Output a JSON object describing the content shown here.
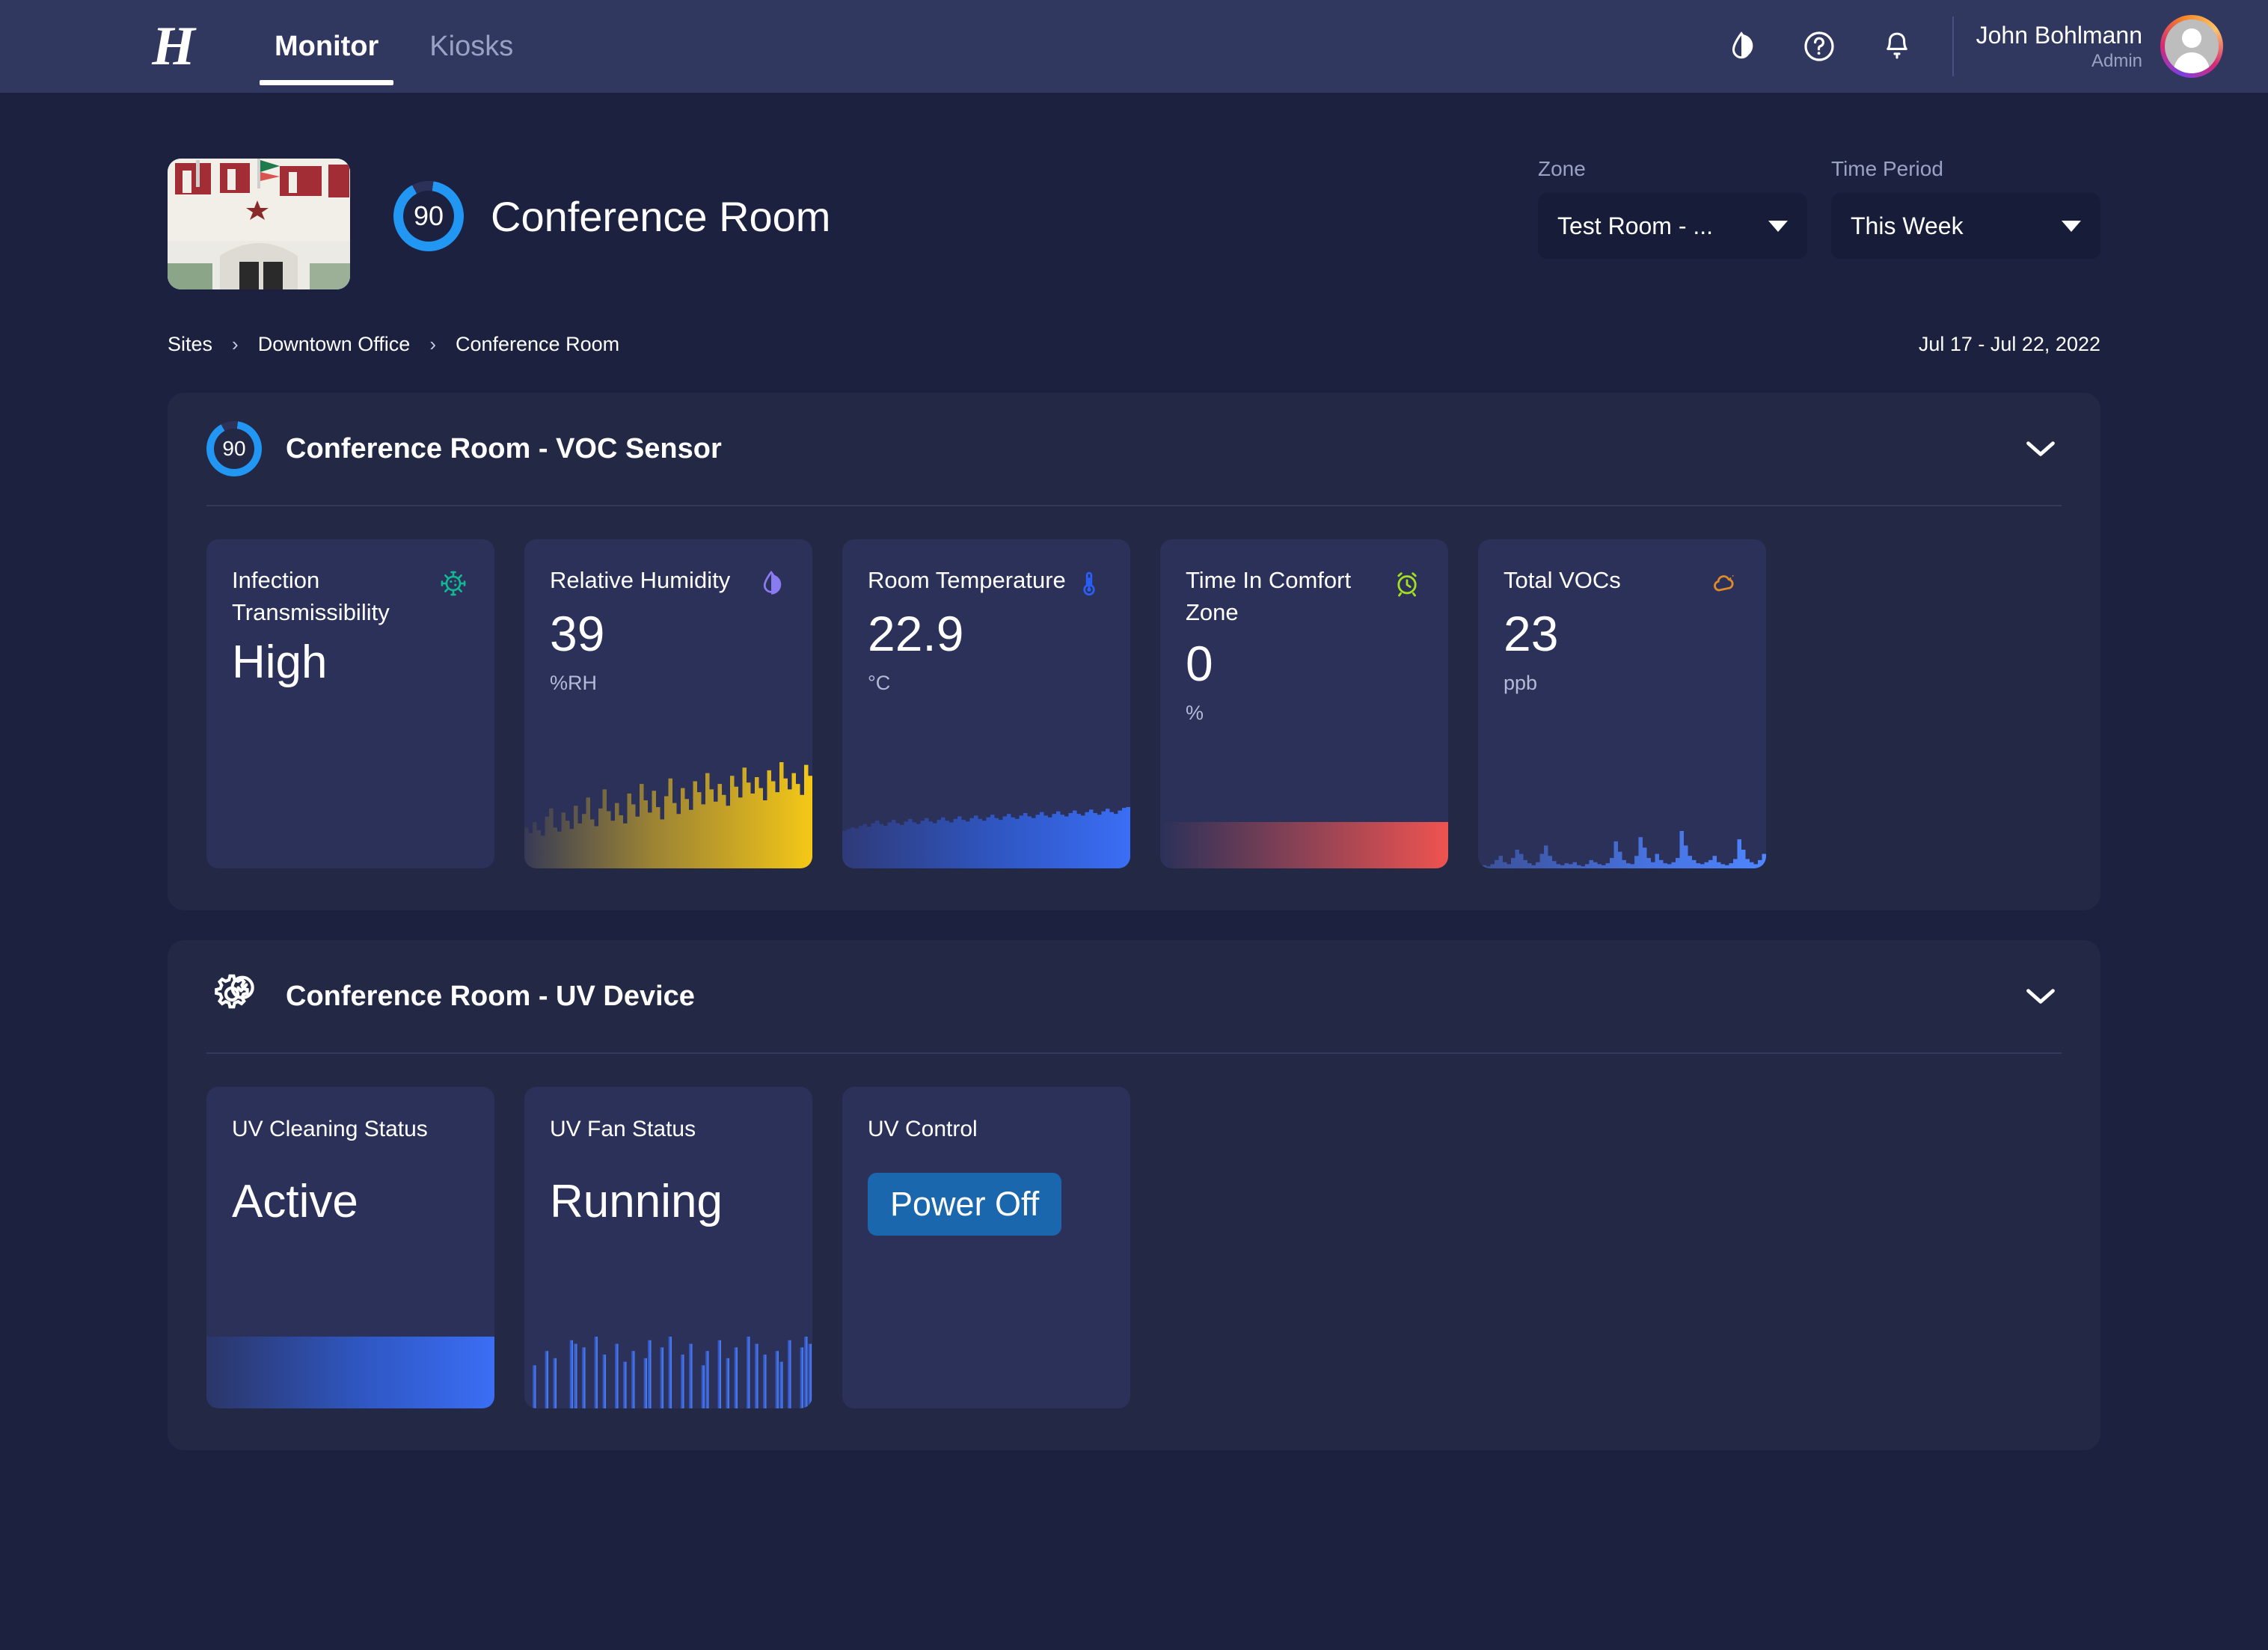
{
  "topbar": {
    "logo_text": "H",
    "tabs": [
      {
        "label": "Monitor",
        "active": true
      },
      {
        "label": "Kiosks",
        "active": false
      }
    ],
    "icons": [
      "contrast-droplet-icon",
      "help-icon",
      "notification-bell-icon"
    ],
    "user": {
      "name": "John Bohlmann",
      "role": "Admin"
    }
  },
  "pagehead": {
    "score": "90",
    "title": "Conference Room",
    "zone": {
      "label": "Zone",
      "value": "Test Room - ..."
    },
    "time_period": {
      "label": "Time Period",
      "value": "This Week"
    }
  },
  "breadcrumb": {
    "items": [
      "Sites",
      "Downtown Office",
      "Conference Room"
    ],
    "separator": "›",
    "date_range": "Jul 17 - Jul 22, 2022"
  },
  "panels": [
    {
      "score": "90",
      "title": "Conference Room - VOC Sensor",
      "cards": [
        {
          "label": "Infection Transmissibility",
          "value": "High",
          "unit": "",
          "icon": "virus-icon",
          "icon_color": "#12b894",
          "chart": "none"
        },
        {
          "label": "Relative Humidity",
          "value": "39",
          "unit": "%RH",
          "icon": "humidity-droplet-icon",
          "icon_color": "#8a7bf0",
          "chart": "gold-area"
        },
        {
          "label": "Room Temperature",
          "value": "22.9",
          "unit": "°C",
          "icon": "thermometer-icon",
          "icon_color": "#2a5ff5",
          "chart": "blue-area"
        },
        {
          "label": "Time In Comfort Zone",
          "value": "0",
          "unit": "%",
          "icon": "alarm-clock-icon",
          "icon_color": "#a4e021",
          "chart": "red-band"
        },
        {
          "label": "Total VOCs",
          "value": "23",
          "unit": "ppb",
          "icon": "odor-cloud-icon",
          "icon_color": "#e08b28",
          "chart": "voc-spikes"
        }
      ]
    },
    {
      "icon": "gear-check-icon",
      "title": "Conference Room - UV Device",
      "cards": [
        {
          "label": "UV Cleaning Status",
          "value": "Active",
          "chart": "solid-blue-band"
        },
        {
          "label": "UV Fan Status",
          "value": "Running",
          "chart": "blue-bars"
        },
        {
          "label": "UV Control",
          "button": "Power Off",
          "chart": "none"
        }
      ]
    }
  ],
  "colors": {
    "page_bg": "#1c2140",
    "topbar_bg": "#313860",
    "panel_bg": "#232845",
    "card_bg": "#2b3159",
    "accent_blue": "#2196f3",
    "button_blue": "#1b67ad",
    "gold": "#f0c419",
    "red": "#ef5350"
  },
  "chart_data": [
    {
      "type": "area",
      "title": "Relative Humidity",
      "ylabel": "%RH",
      "values": [
        30,
        26,
        34,
        28,
        24,
        38,
        44,
        30,
        27,
        41,
        35,
        29,
        46,
        33,
        40,
        52,
        36,
        31,
        44,
        58,
        42,
        35,
        48,
        39,
        33,
        55,
        47,
        38,
        62,
        50,
        41,
        57,
        45,
        36,
        53,
        66,
        48,
        40,
        59,
        51,
        43,
        64,
        56,
        47,
        70,
        58,
        49,
        62,
        54,
        46,
        68,
        60,
        52,
        74,
        63,
        55,
        67,
        59,
        50,
        72,
        64,
        56,
        78,
        66,
        58,
        70,
        62,
        54,
        76,
        68
      ]
    },
    {
      "type": "area",
      "title": "Room Temperature",
      "ylabel": "°C",
      "values": [
        44,
        46,
        48,
        47,
        50,
        52,
        49,
        53,
        56,
        52,
        50,
        54,
        57,
        53,
        51,
        55,
        58,
        54,
        52,
        56,
        59,
        55,
        53,
        57,
        60,
        56,
        54,
        58,
        61,
        57,
        55,
        59,
        62,
        58,
        56,
        60,
        63,
        59,
        57,
        61,
        64,
        60,
        58,
        62,
        65,
        61,
        59,
        63,
        66,
        62,
        60,
        64,
        67,
        63,
        61,
        65,
        68,
        64,
        62,
        66,
        69,
        65,
        63,
        67,
        70,
        66,
        64,
        68,
        71,
        72
      ]
    },
    {
      "type": "area",
      "title": "Time In Comfort Zone",
      "ylabel": "%",
      "values": [
        0,
        0,
        0,
        0,
        0,
        0,
        0,
        0,
        0,
        0,
        0,
        0,
        0,
        0,
        0,
        0,
        0,
        0,
        0,
        0
      ]
    },
    {
      "type": "area",
      "title": "Total VOCs",
      "ylabel": "ppb",
      "values": [
        2,
        3,
        2,
        4,
        8,
        12,
        6,
        4,
        10,
        18,
        14,
        8,
        5,
        3,
        6,
        14,
        22,
        12,
        7,
        4,
        3,
        5,
        4,
        6,
        3,
        2,
        4,
        8,
        6,
        4,
        3,
        5,
        10,
        26,
        16,
        8,
        5,
        4,
        12,
        30,
        20,
        10,
        6,
        14,
        8,
        5,
        4,
        6,
        10,
        36,
        22,
        12,
        8,
        5,
        4,
        6,
        8,
        12,
        6,
        4,
        3,
        5,
        9,
        28,
        18,
        9,
        6,
        4,
        8,
        14
      ]
    },
    {
      "type": "area",
      "title": "UV Cleaning Status",
      "values": [
        100,
        100,
        100,
        100,
        100,
        100,
        100,
        100,
        100,
        100,
        100,
        100,
        100,
        100,
        100,
        100,
        100,
        100,
        100,
        100
      ]
    },
    {
      "type": "bar",
      "title": "UV Fan Status",
      "values": [
        0,
        0,
        60,
        0,
        0,
        80,
        0,
        70,
        0,
        0,
        0,
        95,
        90,
        0,
        85,
        0,
        0,
        100,
        0,
        75,
        0,
        0,
        90,
        0,
        65,
        0,
        80,
        0,
        0,
        70,
        95,
        0,
        0,
        85,
        0,
        100,
        0,
        0,
        75,
        0,
        90,
        0,
        0,
        60,
        80,
        0,
        0,
        95,
        0,
        70,
        0,
        85,
        0,
        0,
        100,
        0,
        90,
        0,
        75,
        0,
        0,
        80,
        65,
        0,
        95,
        0,
        0,
        85,
        100,
        90
      ]
    }
  ]
}
